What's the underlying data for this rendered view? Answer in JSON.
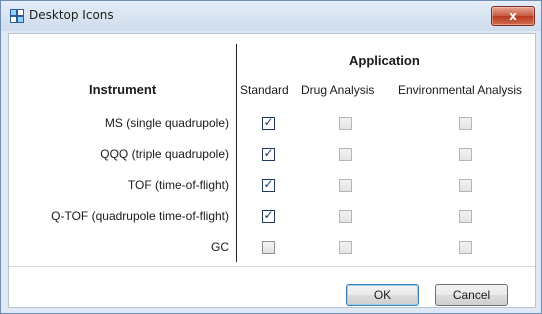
{
  "window": {
    "title": "Desktop Icons",
    "close_label": "x"
  },
  "table": {
    "group_header": "Application",
    "row_header": "Instrument",
    "columns": [
      "Standard",
      "Drug Analysis",
      "Environmental Analysis"
    ],
    "rows": [
      {
        "label": "MS (single quadrupole)",
        "checks": [
          true,
          false,
          false
        ]
      },
      {
        "label": "QQQ (triple quadrupole)",
        "checks": [
          true,
          false,
          false
        ]
      },
      {
        "label": "TOF (time-of-flight)",
        "checks": [
          true,
          false,
          false
        ]
      },
      {
        "label": "Q-TOF (quadrupole time-of-flight)",
        "checks": [
          true,
          false,
          false
        ]
      },
      {
        "label": "GC",
        "checks": [
          false,
          false,
          false
        ]
      }
    ]
  },
  "buttons": {
    "ok": "OK",
    "cancel": "Cancel"
  }
}
